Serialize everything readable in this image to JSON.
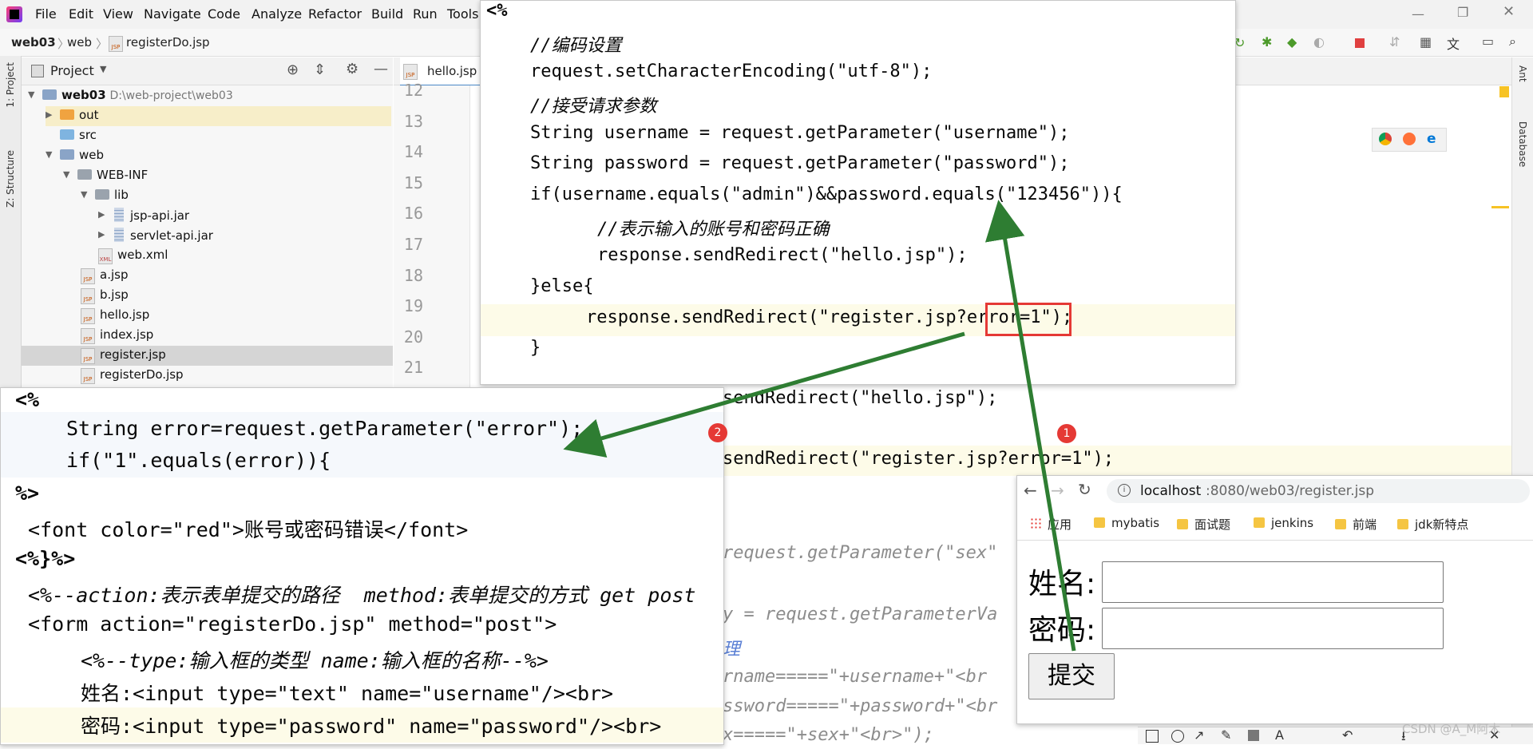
{
  "menu": [
    "File",
    "Edit",
    "View",
    "Navigate",
    "Code",
    "Analyze",
    "Refactor",
    "Build",
    "Run",
    "Tools"
  ],
  "breadcrumb": {
    "project": "web03",
    "folder": "web",
    "file": "registerDo.jsp"
  },
  "left_strip": {
    "project": "1: Project",
    "structure": "Z: Structure"
  },
  "project_panel": {
    "title": "Project",
    "root": {
      "name": "web03",
      "path": "D:\\web-project\\web03"
    },
    "items": [
      "out",
      "src",
      "web",
      "WEB-INF",
      "lib",
      "jsp-api.jar",
      "servlet-api.jar",
      "web.xml",
      "a.jsp",
      "b.jsp",
      "hello.jsp",
      "index.jsp",
      "register.jsp",
      "registerDo.jsp"
    ]
  },
  "editor": {
    "tab": "hello.jsp",
    "line_numbers": [
      "12",
      "13",
      "14",
      "15",
      "16",
      "17",
      "18",
      "19",
      "20",
      "21"
    ],
    "bg_code": [
      "sendRedirect(\"hello.jsp\");",
      "sendRedirect(\"register.jsp?error=1\");",
      "request.getParameter(\"sex\"",
      "y = request.getParameterVa",
      "理",
      "rname=====\"+username+\"<br",
      "ssword=====\"+password+\"<br",
      "x=====\"+sex+\"<br>\");"
    ]
  },
  "right_strip": {
    "ant": "Ant",
    "database": "Database"
  },
  "popup_top": {
    "open_tag": "<%",
    "lines": [
      "//编码设置",
      "request.setCharacterEncoding(\"utf-8\");",
      "//接受请求参数",
      "String username = request.getParameter(\"username\");",
      "String password = request.getParameter(\"password\");",
      "if(username.equals(\"admin\")&&password.equals(\"123456\")){",
      "//表示输入的账号和密码正确",
      "response.sendRedirect(\"hello.jsp\");",
      "}else{",
      "response.sendRedirect(\"register.jsp?error=1\");",
      "}"
    ]
  },
  "popup_left": {
    "lines": [
      "<%",
      "String error=request.getParameter(\"error\");",
      "if(\"1\".equals(error)){",
      "%>",
      "<font color=\"red\">账号或密码错误</font>",
      "<%}%>",
      "<%--action:表示表单提交的路径  method:表单提交的方式 get post",
      "<form action=\"registerDo.jsp\" method=\"post\">",
      "<%--type:输入框的类型 name:输入框的名称--%>",
      "姓名:<input type=\"text\" name=\"username\"/><br>",
      "密码:<input type=\"password\" name=\"password\"/><br>"
    ]
  },
  "browser": {
    "url_host": "localhost",
    "url_rest": ":8080/web03/register.jsp",
    "bookmarks": [
      "应用",
      "mybatis",
      "面试题",
      "jenkins",
      "前端",
      "jdk新特点"
    ],
    "name_label": "姓名:",
    "password_label": "密码:",
    "submit_label": "提交"
  },
  "badges": [
    "1",
    "2"
  ],
  "watermark": "CSDN @A_M阿木",
  "colors": {
    "string": "#067d17",
    "keyword": "#0033b3",
    "comment": "#8c8c8c",
    "arrow": "#2e7d32",
    "badge": "#e53935",
    "highlight": "#a8d1f5"
  }
}
